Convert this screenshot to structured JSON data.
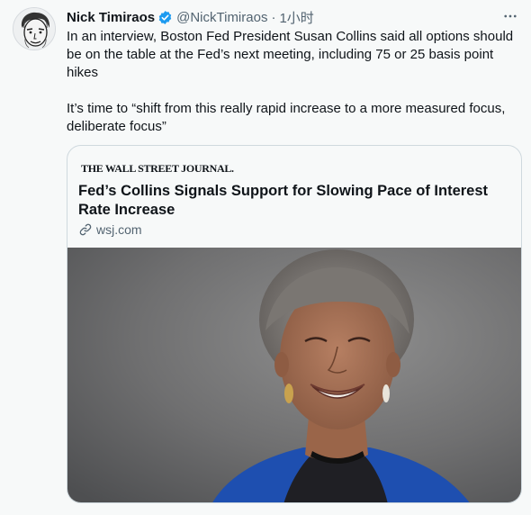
{
  "tweet": {
    "author_name": "Nick Timiraos",
    "handle": "@NickTimiraos",
    "separator": "·",
    "time": "1小时",
    "paragraph_1": "In an interview, Boston Fed President Susan Collins said all options should be on the table at the Fed’s next meeting, including 75 or 25 basis point hikes",
    "paragraph_2": "It’s time to “shift from this really rapid increase to a more measured focus, deliberate focus”",
    "icons": {
      "avatar": "author-avatar",
      "verified": "verified-badge-icon",
      "more": "more-options-icon",
      "link": "link-icon"
    },
    "colors": {
      "verified": "#1d9bf0",
      "muted": "#536471",
      "text": "#0f1419"
    }
  },
  "card": {
    "publication": "THE WALL STREET JOURNAL.",
    "title": "Fed’s Collins Signals Support for Slowing Pace of Interest Rate Increase",
    "domain": "wsj.com",
    "image": "portrait-photo"
  }
}
